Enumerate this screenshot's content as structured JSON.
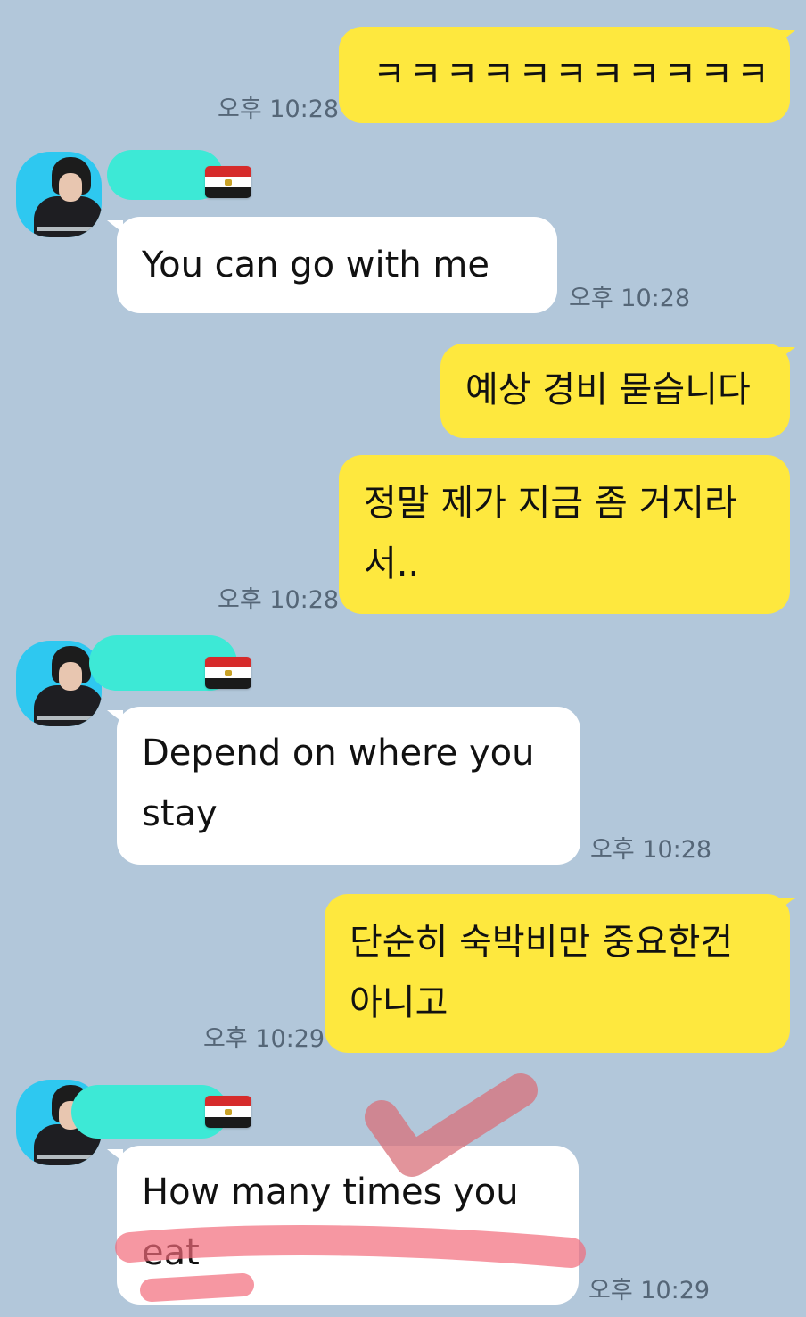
{
  "chat": {
    "messages": [
      {
        "side": "me",
        "text": "ㅋㅋㅋㅋㅋㅋㅋㅋㅋㅋㅋ",
        "time": "오후 10:28"
      },
      {
        "side": "them",
        "text": "You can go with me",
        "time": "오후 10:28",
        "flag": "egypt-flag-icon"
      },
      {
        "side": "me",
        "text": "예상 경비 묻습니다"
      },
      {
        "side": "me",
        "line1": "정말 제가 지금 좀 거지라",
        "line2": "서..",
        "time": "오후 10:28"
      },
      {
        "side": "them",
        "line1": "Depend on where you",
        "line2": "stay",
        "time": "오후 10:28",
        "flag": "egypt-flag-icon"
      },
      {
        "side": "me",
        "line1": "단순히 숙박비만 중요한건",
        "line2": "아니고",
        "time": "오후 10:29"
      },
      {
        "side": "them",
        "line1": "How many times you",
        "line2": "eat",
        "time": "오후 10:29",
        "flag": "egypt-flag-icon"
      }
    ]
  },
  "colors": {
    "background": "#b2c7da",
    "my_bubble": "#fee83e",
    "their_bubble": "#ffffff",
    "name_redaction": "#3de9d6",
    "highlight_marks": "#f26b7a"
  }
}
